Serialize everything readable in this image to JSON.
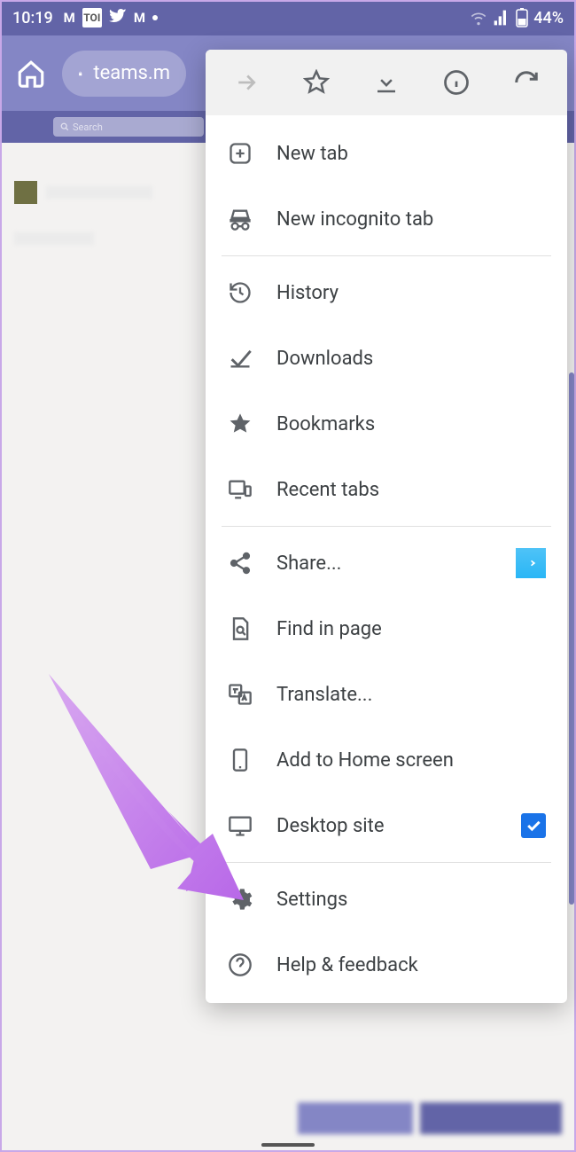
{
  "status": {
    "time": "10:19",
    "battery": "44%",
    "toi": "TOI",
    "m_label": "M"
  },
  "omnibox": {
    "url": "teams.m"
  },
  "teams": {
    "search_placeholder": "Search",
    "ellipsis": "⋯"
  },
  "menu": {
    "new_tab": "New tab",
    "new_incognito": "New incognito tab",
    "history": "History",
    "downloads": "Downloads",
    "bookmarks": "Bookmarks",
    "recent_tabs": "Recent tabs",
    "share": "Share...",
    "find": "Find in page",
    "translate": "Translate...",
    "add_home": "Add to Home screen",
    "desktop": "Desktop site",
    "settings": "Settings",
    "help": "Help & feedback"
  }
}
